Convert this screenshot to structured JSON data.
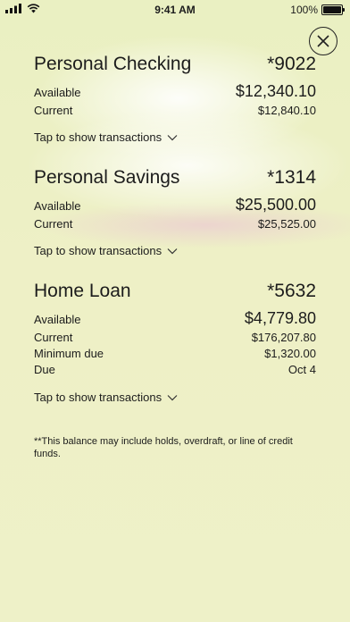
{
  "status_bar": {
    "time": "9:41 AM",
    "battery": "100%"
  },
  "accounts": [
    {
      "name": "Personal Checking",
      "number": "*9022",
      "rows": [
        {
          "label": "Available",
          "value": "$12,340.10"
        },
        {
          "label": "Current",
          "value": "$12,840.10"
        }
      ],
      "tap_label": "Tap to show transactions"
    },
    {
      "name": "Personal Savings",
      "number": "*1314",
      "rows": [
        {
          "label": "Available",
          "value": "$25,500.00"
        },
        {
          "label": "Current",
          "value": "$25,525.00"
        }
      ],
      "tap_label": "Tap to show transactions"
    },
    {
      "name": "Home Loan",
      "number": "*5632",
      "rows": [
        {
          "label": "Available",
          "value": "$4,779.80"
        },
        {
          "label": "Current",
          "value": "$176,207.80"
        },
        {
          "label": "Minimum due",
          "value": "$1,320.00"
        },
        {
          "label": "Due",
          "value": "Oct 4"
        }
      ],
      "tap_label": "Tap to show transactions"
    }
  ],
  "footnote": "**This balance may include holds, overdraft, or line of credit funds."
}
